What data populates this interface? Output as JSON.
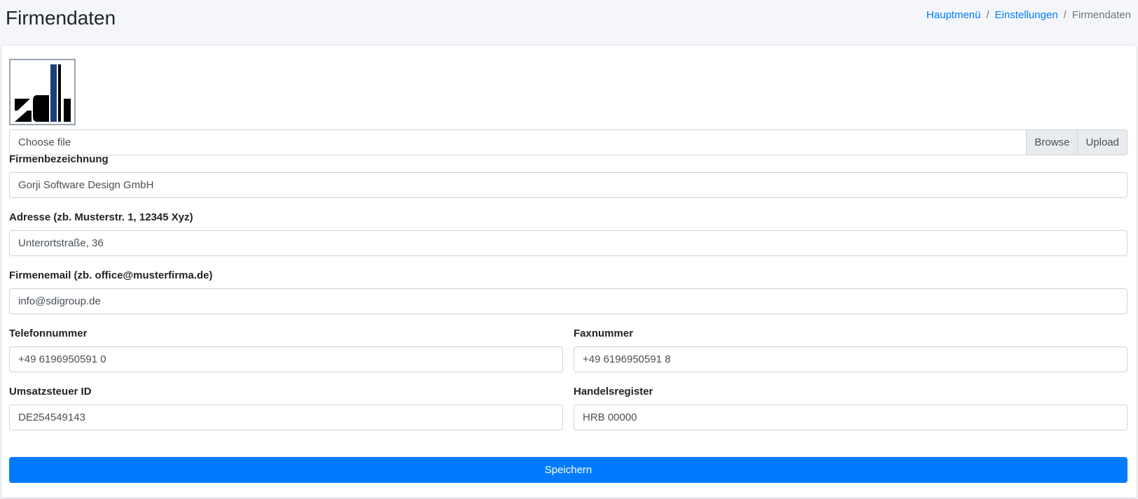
{
  "header": {
    "title": "Firmendaten",
    "breadcrumb": [
      {
        "label": "Hauptmenü"
      },
      {
        "label": "Einstellungen"
      },
      {
        "label": "Firmendaten"
      }
    ]
  },
  "logo": {
    "alt": "sdi logo",
    "colors": {
      "dark": "#000000",
      "accent": "#1f3f7a"
    }
  },
  "file_upload": {
    "placeholder": "Choose file",
    "browse_label": "Browse",
    "upload_label": "Upload"
  },
  "form": {
    "firmenbezeichnung": {
      "label": "Firmenbezeichnung",
      "value": "Gorji Software Design GmbH"
    },
    "adresse": {
      "label": "Adresse (zb. Musterstr. 1, 12345 Xyz)",
      "value": "Unterortstraße, 36"
    },
    "email": {
      "label": "Firmenemail (zb. office@musterfirma.de)",
      "value": "info@sdigroup.de"
    },
    "telefon": {
      "label": "Telefonnummer",
      "value": "+49 6196950591 0"
    },
    "fax": {
      "label": "Faxnummer",
      "value": "+49 6196950591 8"
    },
    "ust_id": {
      "label": "Umsatzsteuer ID",
      "value": "DE254549143"
    },
    "handelsregister": {
      "label": "Handelsregister",
      "value": "HRB 00000"
    },
    "save_label": "Speichern"
  },
  "colors": {
    "primary": "#007bff",
    "page_bg": "#f4f6f9",
    "border": "#ced4da"
  }
}
